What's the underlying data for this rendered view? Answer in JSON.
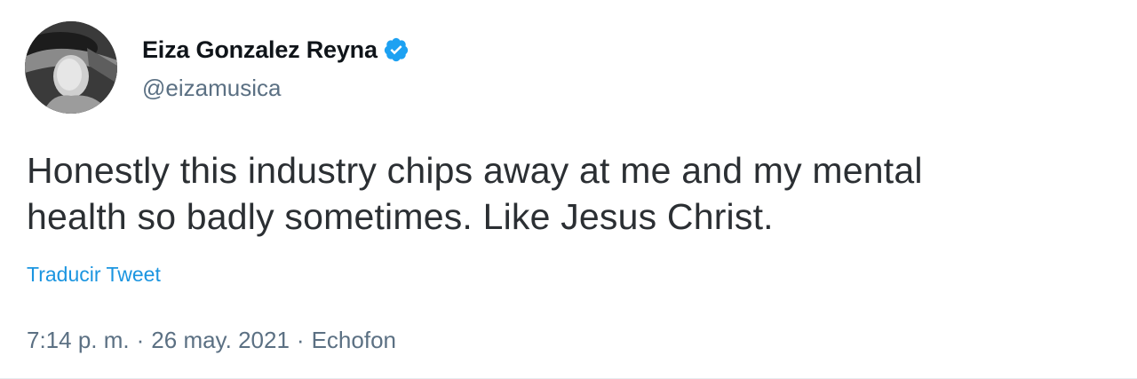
{
  "tweet": {
    "author": {
      "display_name": "Eiza Gonzalez Reyna",
      "handle": "@eizamusica",
      "verified": true,
      "avatar_icon": "profile-photo"
    },
    "more_icon": "more-options-icon",
    "text_line1": "Honestly this industry chips away at me and my mental",
    "text_line2": "health so badly sometimes. Like Jesus Christ.",
    "translate_label": "Traducir Tweet",
    "time": "7:14 p. m.",
    "separator": "·",
    "date": "26 may. 2021",
    "source": "Echofon"
  },
  "colors": {
    "accent": "#1b95e0",
    "verified": "#1da1f2",
    "secondary_text": "#5b7083",
    "primary_text": "#0f1419"
  }
}
